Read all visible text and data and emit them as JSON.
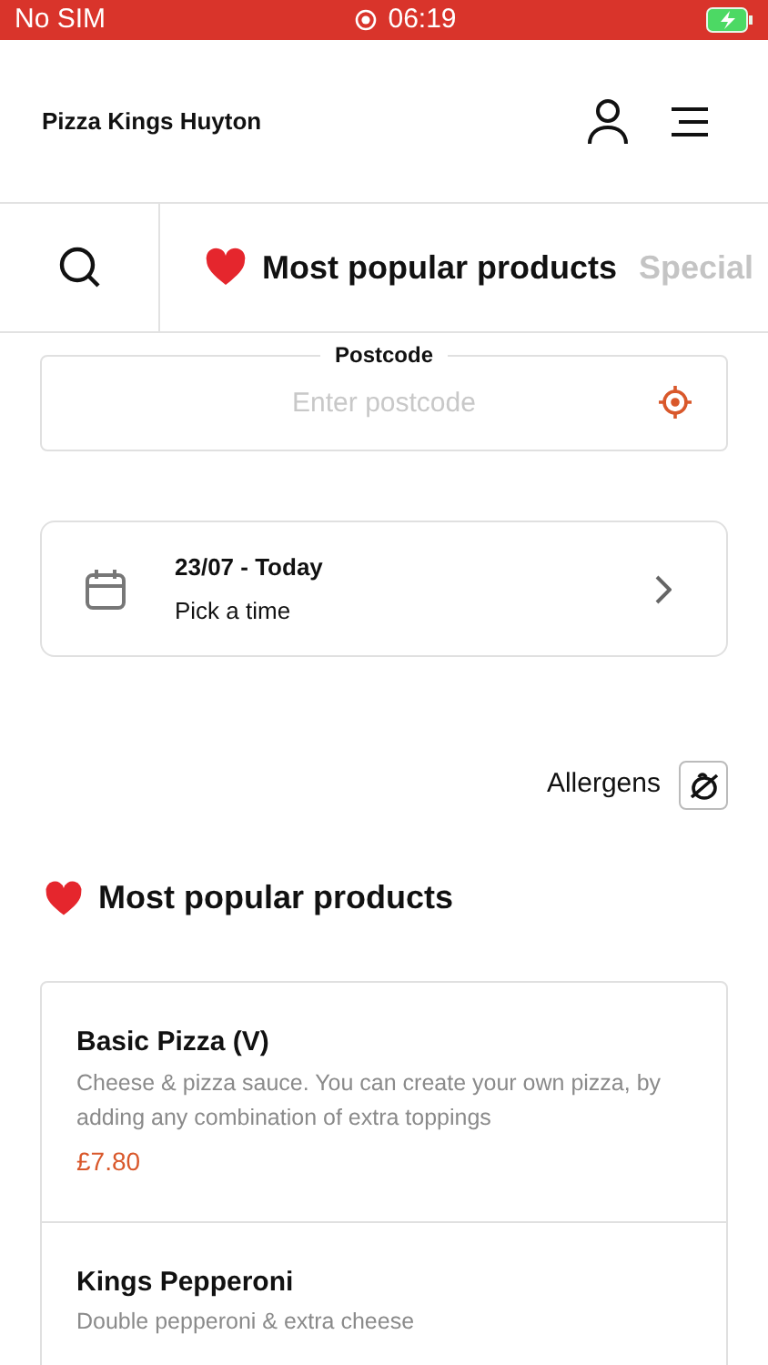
{
  "status_bar": {
    "carrier": "No SIM",
    "time": "06:19"
  },
  "header": {
    "title": "Pizza Kings Huyton"
  },
  "tabs": [
    {
      "label": "Most popular products",
      "selected": true
    },
    {
      "label": "Special",
      "selected": false
    }
  ],
  "postcode": {
    "label": "Postcode",
    "placeholder": "Enter postcode"
  },
  "time_picker": {
    "date": "23/07 - Today",
    "action": "Pick a time"
  },
  "allergens": {
    "label": "Allergens"
  },
  "section": {
    "title": "Most popular products"
  },
  "products": [
    {
      "name": "Basic Pizza (V)",
      "description": "Cheese & pizza sauce. You can create your own pizza, by adding any combination of extra toppings",
      "price": "£7.80"
    },
    {
      "name": "Kings Pepperoni",
      "description": "Double pepperoni & extra cheese"
    }
  ]
}
